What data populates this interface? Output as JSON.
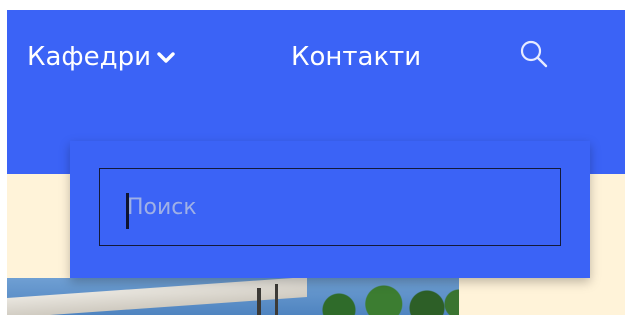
{
  "header": {
    "nav_items": [
      {
        "label": "Кафедри",
        "has_dropdown": true,
        "icon": "chevron-down-icon"
      },
      {
        "label": "Контакти",
        "has_dropdown": false
      }
    ],
    "search_icon": "search-icon"
  },
  "search": {
    "placeholder": "Поиск",
    "value": ""
  },
  "colors": {
    "nav_background": "#3b63f6",
    "content_background": "#fff3d9",
    "text": "#ffffff",
    "input_border": "#141a3a",
    "placeholder": "#9fb0e6"
  }
}
